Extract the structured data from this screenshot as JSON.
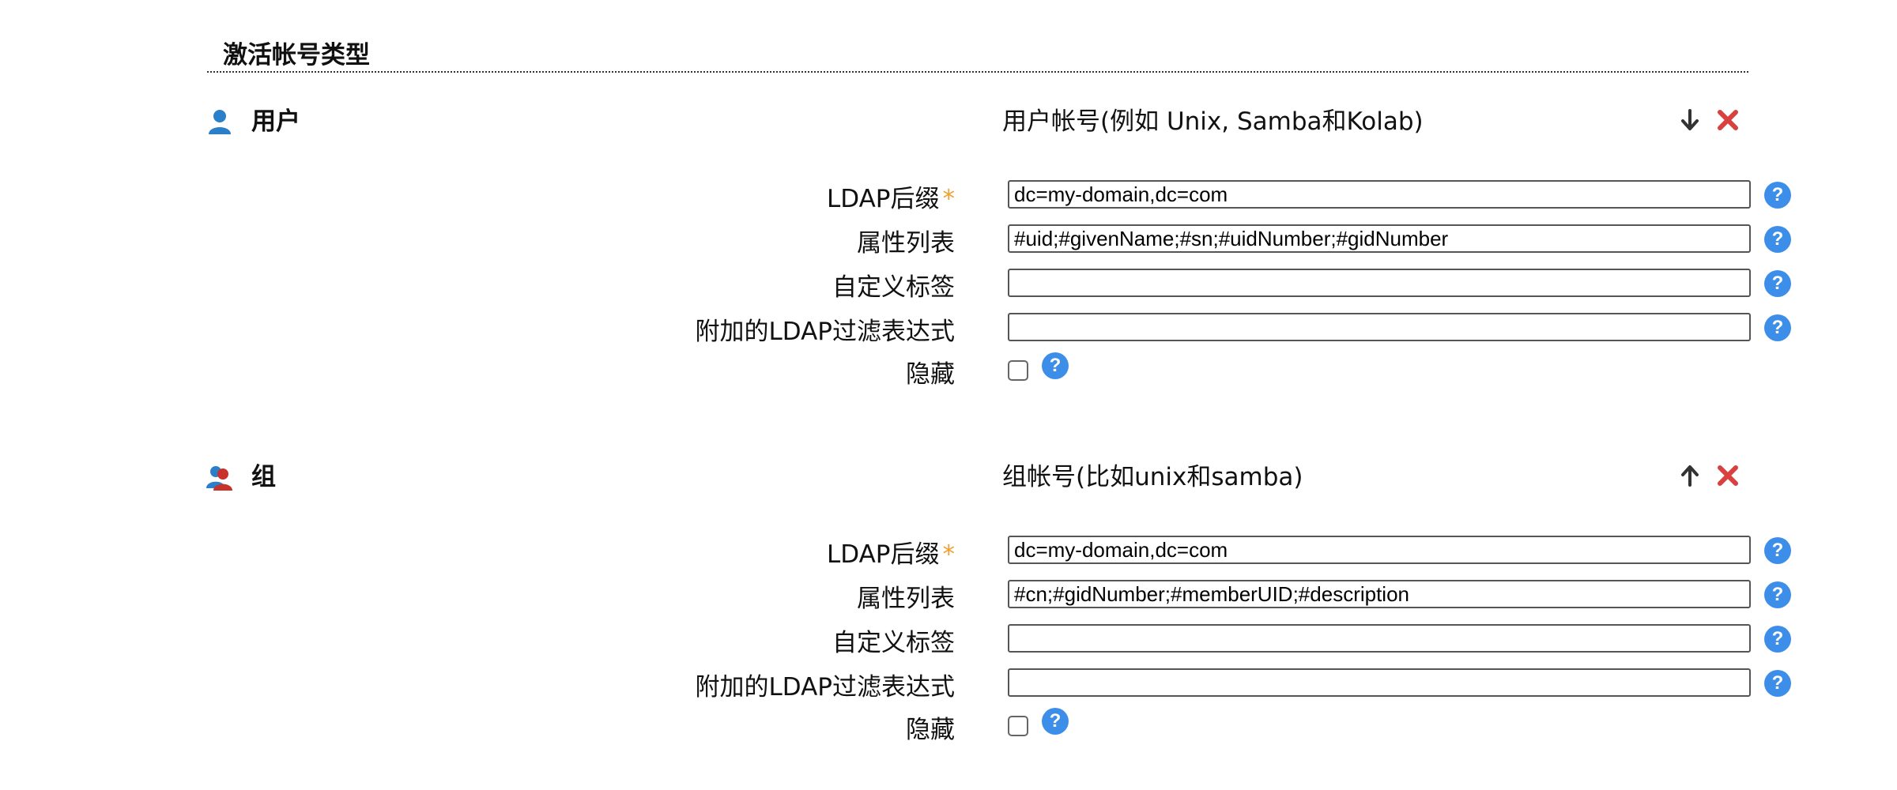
{
  "section": {
    "title": "激活帐号类型"
  },
  "accounts": [
    {
      "name": "用户",
      "icon": "user-icon",
      "description": "用户帐号(例如 Unix, Samba和Kolab)",
      "move_icon": "arrow-down-icon",
      "remove_icon": "remove-x-icon",
      "fields": {
        "suffix": {
          "label": "LDAP后缀",
          "required_mark": "*",
          "value": "dc=my-domain,dc=com"
        },
        "attributes": {
          "label": "属性列表",
          "value": "#uid;#givenName;#sn;#uidNumber;#gidNumber"
        },
        "custom_label": {
          "label": "自定义标签",
          "value": ""
        },
        "filter": {
          "label": "附加的LDAP过滤表达式",
          "value": ""
        },
        "hidden": {
          "label": "隐藏",
          "checked": false
        }
      }
    },
    {
      "name": "组",
      "icon": "group-icon",
      "description": "组帐号(比如unix和samba)",
      "move_icon": "arrow-up-icon",
      "remove_icon": "remove-x-icon",
      "fields": {
        "suffix": {
          "label": "LDAP后缀",
          "required_mark": "*",
          "value": "dc=my-domain,dc=com"
        },
        "attributes": {
          "label": "属性列表",
          "value": "#cn;#gidNumber;#memberUID;#description"
        },
        "custom_label": {
          "label": "自定义标签",
          "value": ""
        },
        "filter": {
          "label": "附加的LDAP过滤表达式",
          "value": ""
        },
        "hidden": {
          "label": "隐藏",
          "checked": false
        }
      }
    }
  ],
  "help": {
    "glyph": "?"
  },
  "colors": {
    "help_blue": "#3d8ee8",
    "remove_red": "#d94040",
    "required_orange": "#f0a030",
    "user_icon_blue": "#2a7fc8",
    "group_icon_red": "#c8322a"
  }
}
